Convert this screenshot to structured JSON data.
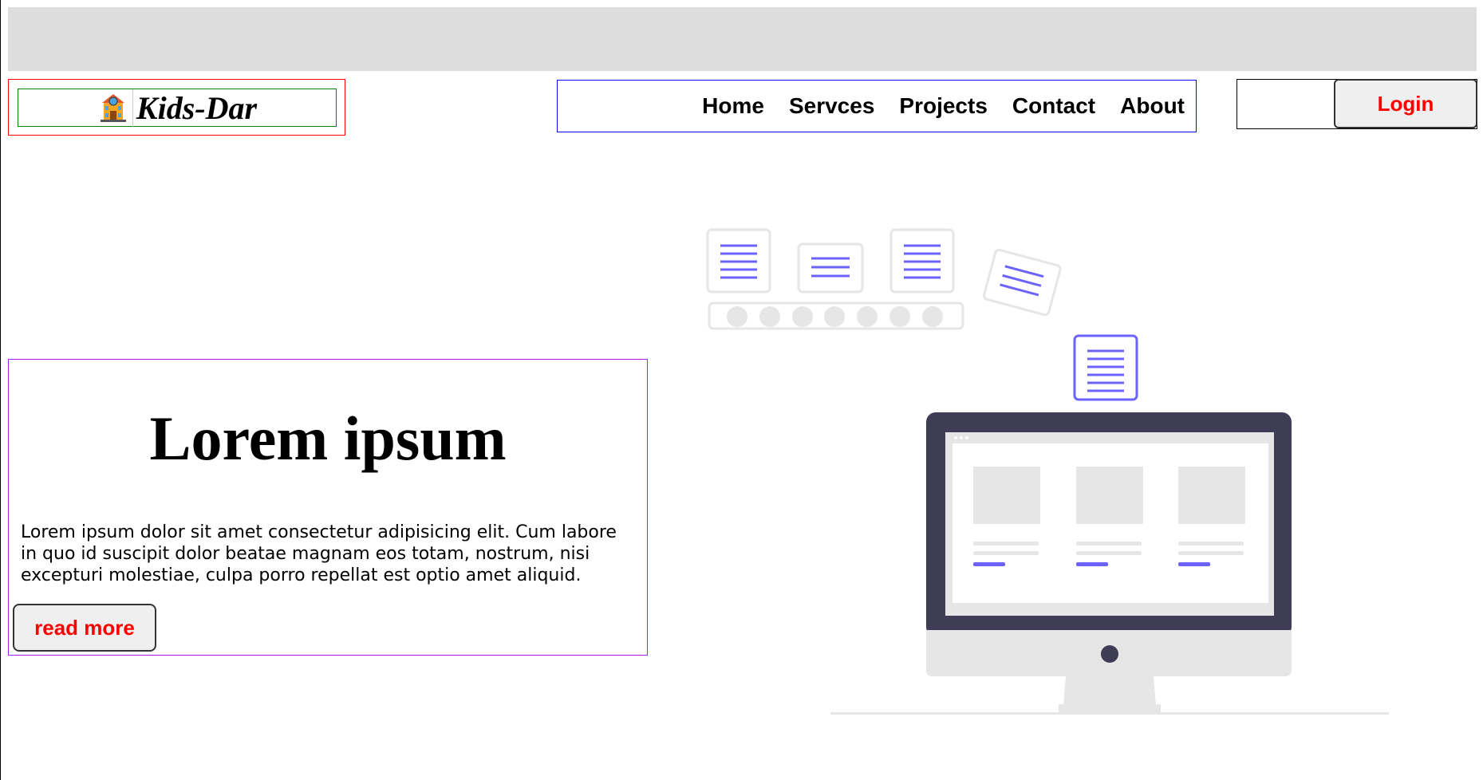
{
  "logo": {
    "text": "Kids-Dar",
    "icon": "school-building-icon"
  },
  "nav": {
    "items": [
      "Home",
      "Servces",
      "Projects",
      "Contact",
      "About"
    ]
  },
  "header": {
    "login_label": "Login"
  },
  "hero": {
    "title": "Lorem ipsum",
    "text": "Lorem ipsum dolor sit amet consectetur adipisicing elit. Cum labore in quo id suscipit dolor beatae magnam eos totam, nostrum, nisi excepturi molestiae, culpa porro repellat est optio amet aliquid.",
    "button_label": "read more"
  },
  "colors": {
    "accent": "#6c63ff",
    "monitor_dark": "#3f3d56",
    "light_gray": "#e6e6e6",
    "button_text": "#ff0000"
  }
}
